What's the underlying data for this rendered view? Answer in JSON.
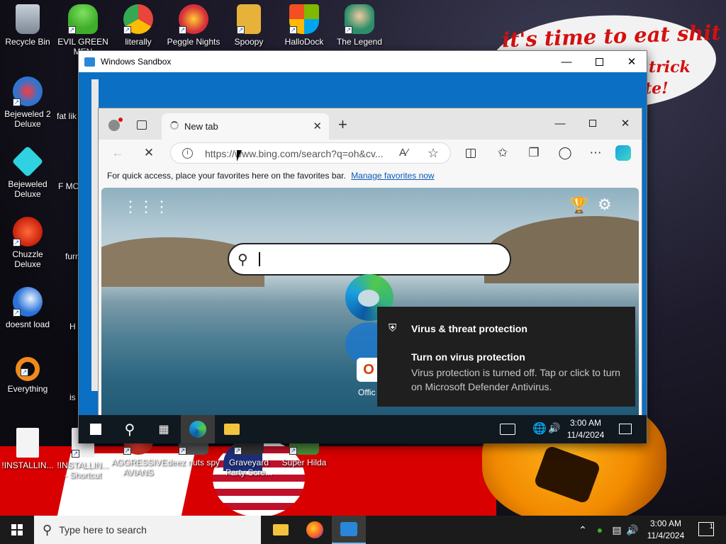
{
  "wallpaper": {
    "speech_line1": "it's time to eat shit",
    "speech_line2a": "trick",
    "speech_line2b": "te!"
  },
  "desktop_icons": [
    {
      "label": "Recycle Bin",
      "icon": "recycle-bin-icon",
      "color": "#9aa6b4"
    },
    {
      "label": "EVIL GREEN MEN",
      "icon": "people-icon",
      "color": "#3fae2a"
    },
    {
      "label": "literally",
      "icon": "chrome-icon",
      "color": "#e8453c"
    },
    {
      "label": "Peggle Nights",
      "icon": "peggle-icon",
      "color": "#d6303a"
    },
    {
      "label": "Spoopy",
      "icon": "folder-icon",
      "color": "#e6b23a"
    },
    {
      "label": "HalloDock",
      "icon": "windows-logo-icon",
      "color": "#f25022"
    },
    {
      "label": "The Legend",
      "icon": "character-icon",
      "color": "#2c8f6a"
    },
    {
      "label": "Bejeweled 2 Deluxe",
      "icon": "gem-icon",
      "color": "#2f74d0"
    },
    {
      "label": "Bejeweled Deluxe",
      "icon": "diamond-icon",
      "color": "#2fd2e0"
    },
    {
      "label": "Chuzzle Deluxe",
      "icon": "chuzzle-icon",
      "color": "#e0301c"
    },
    {
      "label": "doesnt load",
      "icon": "thunderbird-icon",
      "color": "#2a72d8"
    },
    {
      "label": "Everything",
      "icon": "magnifier-icon",
      "color": "#f08a1a"
    },
    {
      "label": "!INSTALLIN...",
      "icon": "document-icon",
      "color": "#f4f4f4"
    },
    {
      "label": "!INSTALLIN... - Shortcut",
      "icon": "document-icon",
      "color": "#f4f4f4"
    },
    {
      "label": "AGGRESSIVE AVIANS",
      "icon": "angry-bird-icon",
      "color": "#c82a20"
    },
    {
      "label": "deez nuts spy",
      "icon": "app-icon",
      "color": "#555555"
    },
    {
      "label": "Graveyard Party Scre...",
      "icon": "app-icon",
      "color": "#333333"
    },
    {
      "label": "Super Hilda",
      "icon": "app-icon",
      "color": "#4a8a3a"
    }
  ],
  "partial_labels": [
    "fat lik",
    "R",
    "F MON",
    "furr",
    "H W",
    "is"
  ],
  "sandbox": {
    "title": "Windows Sandbox",
    "clock_time": "3:00 AM",
    "clock_date": "11/4/2024"
  },
  "edge": {
    "tab_label": "New tab",
    "url": "https://www.bing.com/search?q=oh&cv...",
    "favorites_text": "For quick access, place your favorites here on the favorites bar.",
    "favorites_link": "Manage favorites now",
    "office_label": "Offic"
  },
  "toast": {
    "title": "Virus & threat protection",
    "heading": "Turn on virus protection",
    "body": "Virus protection is turned off. Tap or click to turn on Microsoft Defender Antivirus."
  },
  "taskbar": {
    "search_placeholder": "Type here to search",
    "clock_time": "3:00 AM",
    "clock_date": "11/4/2024",
    "notification_count": "1"
  },
  "colors": {
    "edge_accent": "#0a58b8",
    "sandbox_bg": "#0b6fc4",
    "taskbar": "#1b1b1b"
  }
}
